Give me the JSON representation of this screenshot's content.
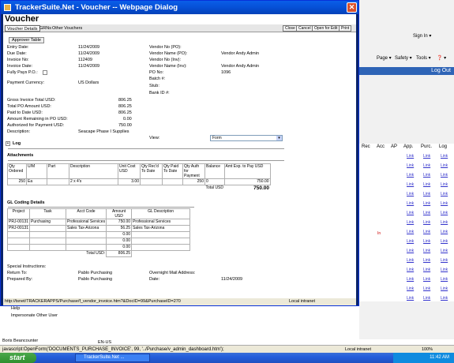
{
  "background": {
    "toolbar": {
      "page": "Page ▾",
      "safety": "Safety ▾",
      "tools": "Tools ▾",
      "help": "❓ ▾",
      "sign_in": "Sign In ▾"
    },
    "logout": "Log Out",
    "grid_headers": [
      "Rec",
      "Acc",
      "AP",
      "App.",
      "Purc.",
      "Log"
    ],
    "link_text": "Link",
    "in_text": "In",
    "left_items": {
      "help": "Help",
      "impersonate": "Impersonate Other User",
      "user": "Boris Beancounter"
    },
    "locale": "EN-US"
  },
  "ie_status": {
    "text": "javascript:OpenForm('DOCUMENTS_PURCHASE_INVOICE', 99, '../Purchase/v_admin_dashboard.htm');",
    "zone": "Local intranet",
    "zoom": "100%"
  },
  "taskbar": {
    "start": "start",
    "item": "TrackerSuite.Net ...",
    "clock": "11:42 AM"
  },
  "dialog": {
    "title": "TrackerSuite.Net - Voucher -- Webpage Dialog",
    "heading": "Voucher",
    "tabs": [
      "Voucher Details",
      "GRNs",
      "Other Vouchers"
    ],
    "buttons": [
      "Close",
      "Cancel",
      "Open for Edit",
      "Print"
    ],
    "approver_table": "Approver Table",
    "fields_left": [
      {
        "label": "Entry Date:",
        "value": "11/24/2009"
      },
      {
        "label": "Due Date:",
        "value": "11/24/2009"
      },
      {
        "label": "Invoice No:",
        "value": "112409"
      },
      {
        "label": "Invoice Date:",
        "value": "11/24/2009"
      },
      {
        "label": "Fully Pays P.O.:",
        "value": ""
      },
      {
        "label": "Payment Currency:",
        "value": "US Dollars"
      }
    ],
    "fields_right": [
      {
        "label": "Vendor No (PO):",
        "value": ""
      },
      {
        "label": "Vendor Name (PO):",
        "value": "Vendor Andy Admin"
      },
      {
        "label": "Vendor No (Inv):",
        "value": ""
      },
      {
        "label": "Vendor Name (Inv):",
        "value": "Vendor Andy Admin"
      },
      {
        "label": "PO No:",
        "value": "1096"
      },
      {
        "label": "Batch #:",
        "value": ""
      },
      {
        "label": "Stub:",
        "value": ""
      },
      {
        "label": "Bank ID #:",
        "value": ""
      }
    ],
    "totals": [
      {
        "label": "Gross Invoice Total USD:",
        "value": "806.25"
      },
      {
        "label": "Total PO Amount USD:",
        "value": "806.25"
      },
      {
        "label": "Paid to Date USD:",
        "value": "806.25"
      },
      {
        "label": "Amount Remaining in PO USD:",
        "value": "0.00"
      },
      {
        "label": "Authorized for Payment USD:",
        "value": "750.00"
      },
      {
        "label": "Description:",
        "value": "Seacape Phase I Supplies"
      }
    ],
    "view_label": "View:",
    "view_value": "Form",
    "log_label": "Log",
    "attachments_label": "Attachments",
    "line_headers": [
      "Qty Ordered",
      "U/M",
      "Part",
      "Description",
      "Unit Cost USD",
      "Qty Rec'd To Date",
      "Qty Paid To Date",
      "Qty Auth for Payment",
      "Balance",
      "Amt Exp. to Pay USD"
    ],
    "line_row": [
      "250",
      "Ea",
      "",
      "2 x 4's",
      "3.00",
      "",
      "",
      "250",
      "0",
      "750.00"
    ],
    "line_total_label": "Total USD",
    "line_total_value": "750.00",
    "gl_label": "GL Coding Details",
    "gl_headers": [
      "Project",
      "Task",
      "Acct Code",
      "Amount USD",
      "GL Description"
    ],
    "gl_rows": [
      [
        "PRJ-00131",
        "Purchasing",
        "Professional Services",
        "750.00",
        "Professional Services"
      ],
      [
        "PRJ-00131",
        "",
        "Sales Tax-Arizona",
        "56.25",
        "Sales Tax-Arizona"
      ],
      [
        "",
        "",
        "",
        "0.00",
        ""
      ],
      [
        "",
        "",
        "",
        "0.00",
        ""
      ],
      [
        "",
        "",
        "",
        "0.00",
        ""
      ]
    ],
    "gl_total_label": "Total USD:",
    "gl_total_value": "806.25",
    "special_instructions": "Special Instructions:",
    "return_to_label": "Return To:",
    "return_to_value": "Pablo Purchasing",
    "prepared_by_label": "Prepared By:",
    "prepared_by_value": "Pablo Purchasing",
    "overnight_label": "Overnight Mail Address:",
    "date_label": "Date:",
    "date_value": "11/24/2009",
    "status_url": "http://tsnet/TRACKERAPPS/Purchase/f_vendor_invoice.htm?&DocID=99&PurchaseID=270",
    "status_zone": "Local intranet"
  }
}
